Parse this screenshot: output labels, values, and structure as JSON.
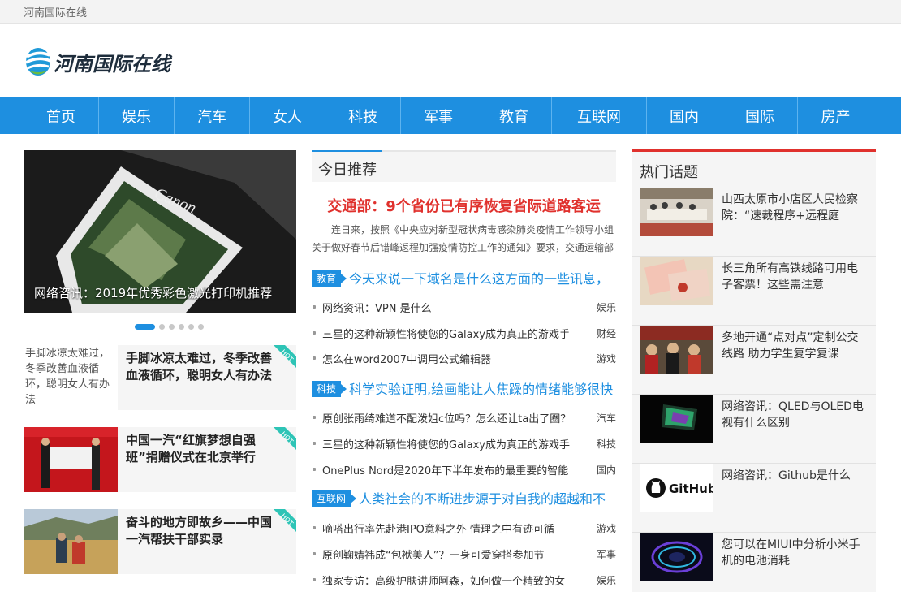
{
  "topbar": {
    "site_name": "河南国际在线"
  },
  "logo": {
    "text": "河南国际在线"
  },
  "nav": {
    "items": [
      {
        "label": "首页"
      },
      {
        "label": "娱乐"
      },
      {
        "label": "汽车"
      },
      {
        "label": "女人"
      },
      {
        "label": "科技"
      },
      {
        "label": "军事"
      },
      {
        "label": "教育"
      },
      {
        "label": "互联网"
      },
      {
        "label": "国内"
      },
      {
        "label": "国际"
      },
      {
        "label": "房产"
      }
    ]
  },
  "slider": {
    "caption": "网络咨讯：2019年优秀彩色激光打印机推荐",
    "dots": 6,
    "active_index": 0
  },
  "hot_cards": [
    {
      "title": "手脚冰凉太难过，冬季改善血液循环，聪明女人有办法",
      "image_alt": "手脚冰凉太难过，冬季改善血液循环，聪明女人有办法",
      "badge": "HOT"
    },
    {
      "title": "中国一汽“红旗梦想自强班”捐赠仪式在北京举行",
      "badge": "HOT"
    },
    {
      "title": "奋斗的地方即故乡——中国一汽帮扶干部实录",
      "badge": "HOT"
    }
  ],
  "today": {
    "heading": "今日推荐",
    "headline": "交通部：9个省份已有序恢复省际道路客运",
    "summary": "连日来，按照《中央应对新型冠状病毒感染肺炎疫情工作领导小组关于做好春节后错峰返程加强疫情防控工作的通知》要求，交通运输部"
  },
  "sections": [
    {
      "tag": "教育",
      "title": "今天来说一下域名是什么这方面的一些讯息，",
      "items": [
        {
          "text": "网络资讯：VPN 是什么",
          "category": "娱乐"
        },
        {
          "text": "三星的这种新颖性将使您的Galaxy成为真正的游戏手",
          "category": "财经"
        },
        {
          "text": "怎么在word2007中调用公式编辑器",
          "category": "游戏"
        }
      ]
    },
    {
      "tag": "科技",
      "title": "科学实验证明,绘画能让人焦躁的情绪能够很快",
      "items": [
        {
          "text": "原创张雨绮难道不配泼姐c位吗？怎么还让ta出了圈？",
          "category": "汽车"
        },
        {
          "text": "三星的这种新颖性将使您的Galaxy成为真正的游戏手",
          "category": "科技"
        },
        {
          "text": "OnePlus Nord是2020年下半年发布的最重要的智能",
          "category": "国内"
        }
      ]
    },
    {
      "tag": "互联网",
      "title": "人类社会的不断进步源于对自我的超越和不",
      "items": [
        {
          "text": "嘀嗒出行率先赴港IPO意料之外 情理之中有迹可循",
          "category": "游戏"
        },
        {
          "text": "原创鞠婧祎成“包袱美人”？一身可爱穿搭参加节",
          "category": "军事"
        },
        {
          "text": "独家专访：高级护肤讲师阿森，如何做一个精致的女",
          "category": "娱乐"
        }
      ]
    }
  ],
  "hot_topics": {
    "heading": "热门话题",
    "items": [
      {
        "title": "山西太原市小店区人民检察院：“速裁程序+远程庭"
      },
      {
        "title": "长三角所有高铁线路可用电子客票！这些需注意"
      },
      {
        "title": "多地开通“点对点”定制公交线路 助力学生复学复课"
      },
      {
        "title": "网络咨讯：QLED与OLED电视有什么区别"
      },
      {
        "title": "网络咨讯：Github是什么",
        "image_text": "GitHub"
      },
      {
        "title": "您可以在MIUI中分析小米手机的电池消耗"
      }
    ]
  },
  "colors": {
    "nav_blue": "#1e8fe0",
    "headline_red": "#e0312d",
    "hot_badge": "#2ec4b6"
  }
}
